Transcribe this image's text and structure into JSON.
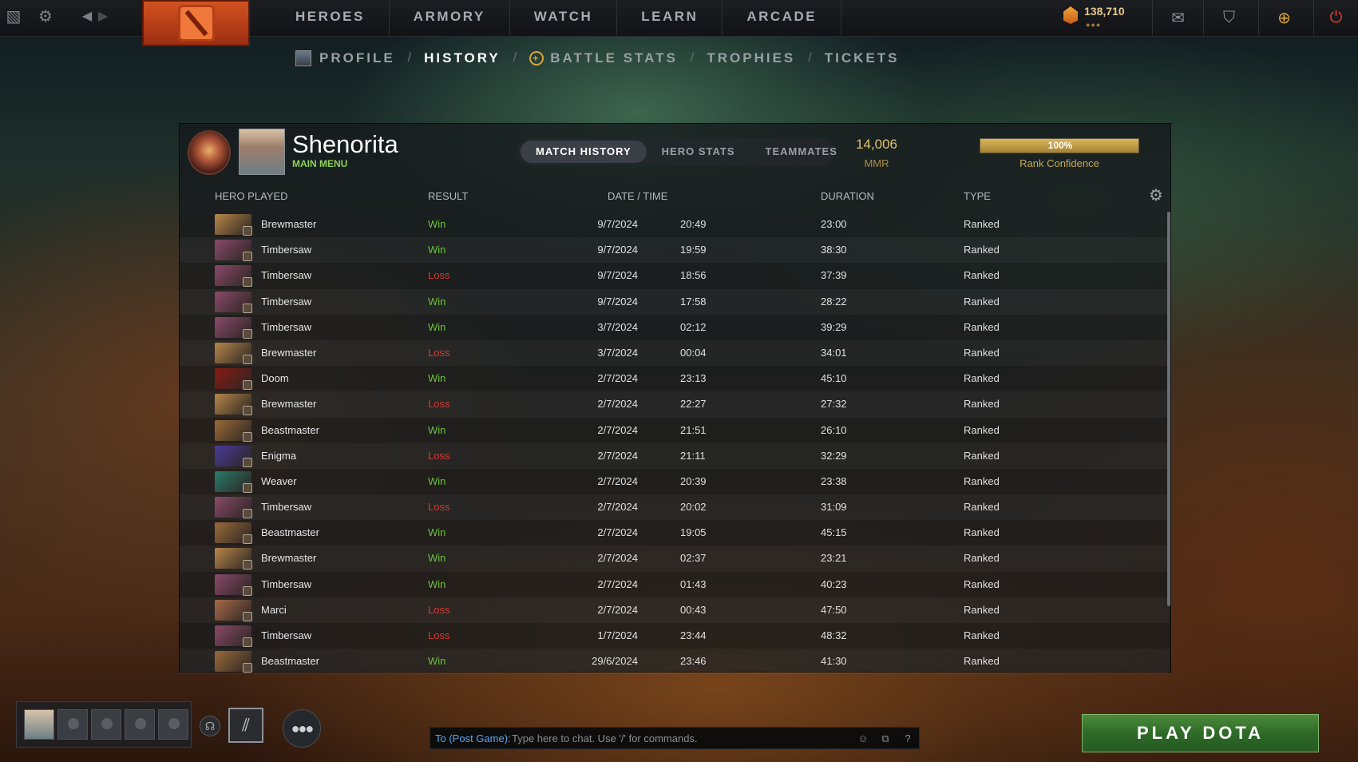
{
  "nav": {
    "items": [
      "HEROES",
      "ARMORY",
      "WATCH",
      "LEARN",
      "ARCADE"
    ],
    "currency": "138,710",
    "currency_dots": "●●●"
  },
  "subnav": {
    "items": [
      "PROFILE",
      "HISTORY",
      "BATTLE STATS",
      "TROPHIES",
      "TICKETS"
    ],
    "active": "HISTORY",
    "separator": "/"
  },
  "player": {
    "name": "Shenorita",
    "status": "MAIN MENU"
  },
  "tabs": {
    "items": [
      "MATCH HISTORY",
      "HERO STATS",
      "TEAMMATES"
    ],
    "active": "MATCH HISTORY"
  },
  "mmr": {
    "value": "14,006",
    "label": "MMR"
  },
  "rank_confidence": {
    "value": "100%",
    "fraction": 1.0,
    "label": "Rank Confidence"
  },
  "columns": {
    "hero": "HERO PLAYED",
    "result": "RESULT",
    "datetime": "DATE / TIME",
    "duration": "DURATION",
    "type": "TYPE"
  },
  "matches": [
    {
      "hero": "Brewmaster",
      "result": "Win",
      "date": "9/7/2024",
      "time": "20:49",
      "duration": "23:00",
      "type": "Ranked"
    },
    {
      "hero": "Timbersaw",
      "result": "Win",
      "date": "9/7/2024",
      "time": "19:59",
      "duration": "38:30",
      "type": "Ranked"
    },
    {
      "hero": "Timbersaw",
      "result": "Loss",
      "date": "9/7/2024",
      "time": "18:56",
      "duration": "37:39",
      "type": "Ranked"
    },
    {
      "hero": "Timbersaw",
      "result": "Win",
      "date": "9/7/2024",
      "time": "17:58",
      "duration": "28:22",
      "type": "Ranked"
    },
    {
      "hero": "Timbersaw",
      "result": "Win",
      "date": "3/7/2024",
      "time": "02:12",
      "duration": "39:29",
      "type": "Ranked"
    },
    {
      "hero": "Brewmaster",
      "result": "Loss",
      "date": "3/7/2024",
      "time": "00:04",
      "duration": "34:01",
      "type": "Ranked"
    },
    {
      "hero": "Doom",
      "result": "Win",
      "date": "2/7/2024",
      "time": "23:13",
      "duration": "45:10",
      "type": "Ranked"
    },
    {
      "hero": "Brewmaster",
      "result": "Loss",
      "date": "2/7/2024",
      "time": "22:27",
      "duration": "27:32",
      "type": "Ranked"
    },
    {
      "hero": "Beastmaster",
      "result": "Win",
      "date": "2/7/2024",
      "time": "21:51",
      "duration": "26:10",
      "type": "Ranked"
    },
    {
      "hero": "Enigma",
      "result": "Loss",
      "date": "2/7/2024",
      "time": "21:11",
      "duration": "32:29",
      "type": "Ranked"
    },
    {
      "hero": "Weaver",
      "result": "Win",
      "date": "2/7/2024",
      "time": "20:39",
      "duration": "23:38",
      "type": "Ranked"
    },
    {
      "hero": "Timbersaw",
      "result": "Loss",
      "date": "2/7/2024",
      "time": "20:02",
      "duration": "31:09",
      "type": "Ranked"
    },
    {
      "hero": "Beastmaster",
      "result": "Win",
      "date": "2/7/2024",
      "time": "19:05",
      "duration": "45:15",
      "type": "Ranked"
    },
    {
      "hero": "Brewmaster",
      "result": "Win",
      "date": "2/7/2024",
      "time": "02:37",
      "duration": "23:21",
      "type": "Ranked"
    },
    {
      "hero": "Timbersaw",
      "result": "Win",
      "date": "2/7/2024",
      "time": "01:43",
      "duration": "40:23",
      "type": "Ranked"
    },
    {
      "hero": "Marci",
      "result": "Loss",
      "date": "2/7/2024",
      "time": "00:43",
      "duration": "47:50",
      "type": "Ranked"
    },
    {
      "hero": "Timbersaw",
      "result": "Loss",
      "date": "1/7/2024",
      "time": "23:44",
      "duration": "48:32",
      "type": "Ranked"
    },
    {
      "hero": "Beastmaster",
      "result": "Win",
      "date": "29/6/2024",
      "time": "23:46",
      "duration": "41:30",
      "type": "Ranked"
    }
  ],
  "hero_colors": {
    "Brewmaster": "#b8864a",
    "Timbersaw": "#8a4a6a",
    "Doom": "#8a1a14",
    "Beastmaster": "#9a6a3a",
    "Enigma": "#4a3a9a",
    "Weaver": "#2a7a6a",
    "Marci": "#a86a4a"
  },
  "colors": {
    "win": "#6cc23f",
    "loss": "#d43a34",
    "accent_gold": "#e2c16b",
    "play_button": "#2e6a28"
  },
  "chat": {
    "to_label": "To (Post Game):",
    "placeholder": "Type here to chat. Use '/' for commands."
  },
  "play_button": "PLAY DOTA",
  "icons": {
    "top_left": [
      "dashboard-icon",
      "settings-icon",
      "back-icon",
      "forward-icon"
    ],
    "top_right": [
      "mail-icon",
      "armory-shield-icon",
      "plus-icon",
      "power-icon"
    ]
  }
}
